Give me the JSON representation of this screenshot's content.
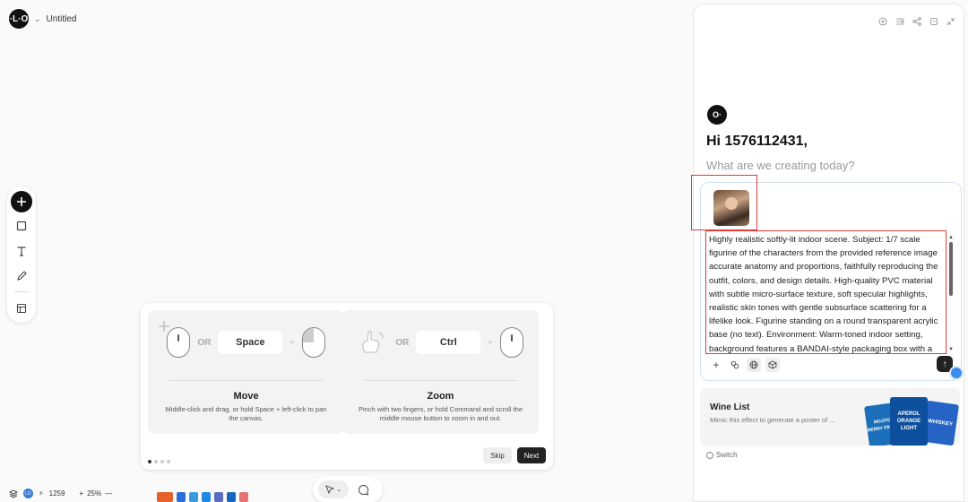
{
  "header": {
    "logo_text": "·L·O",
    "doc_title": "Untitled"
  },
  "toolbar": {
    "tools": [
      "add",
      "rectangle",
      "text",
      "pencil",
      "frame"
    ]
  },
  "tutorial": {
    "move": {
      "or": "OR",
      "key": "Space",
      "plus": "+",
      "title": "Move",
      "desc": "Middle-click and drag, or hold Space + left-click to pan the canvas."
    },
    "zoom": {
      "or": "OR",
      "key": "Ctrl",
      "plus": "+",
      "title": "Zoom",
      "desc": "Pinch with two fingers, or hold Command and scroll the middle mouse button to zoom in and out."
    },
    "skip_label": "Skip",
    "next_label": "Next",
    "page_count": 4,
    "current_page": 1
  },
  "status": {
    "credits": "1259",
    "zoom": "25%",
    "zoom_in": "+",
    "zoom_out": "—"
  },
  "panel": {
    "logo_text": "O·",
    "greeting": "Hi 1576112431,",
    "subgreeting": "What are we creating today?",
    "prompt": "Highly realistic softly-lit indoor scene. Subject: 1/7 scale figurine of the characters from the provided reference image accurate anatomy and proportions, faithfully reproducing the outfit, colors, and design details. High-quality PVC material with subtle micro-surface texture, soft specular highlights, realistic skin tones with gentle subsurface scattering for a lifelike look. Figurine standing on a round transparent acrylic base (no text). Environment: Warm-toned indoor setting, background features a BANDAI-style packaging box with a",
    "send_icon": "↑",
    "suggestion": {
      "title": "Wine List",
      "desc": "Mimic this effect to generate a poster of ...",
      "posters": [
        "MOJITO BERRY FRESH",
        "APEROL ORANGE LIGHT",
        "WHISKEY"
      ]
    },
    "switch_label": "Switch"
  },
  "colors": {
    "accent": "#3d8cf0",
    "highlight_box": "#e53935",
    "dark": "#111111"
  }
}
